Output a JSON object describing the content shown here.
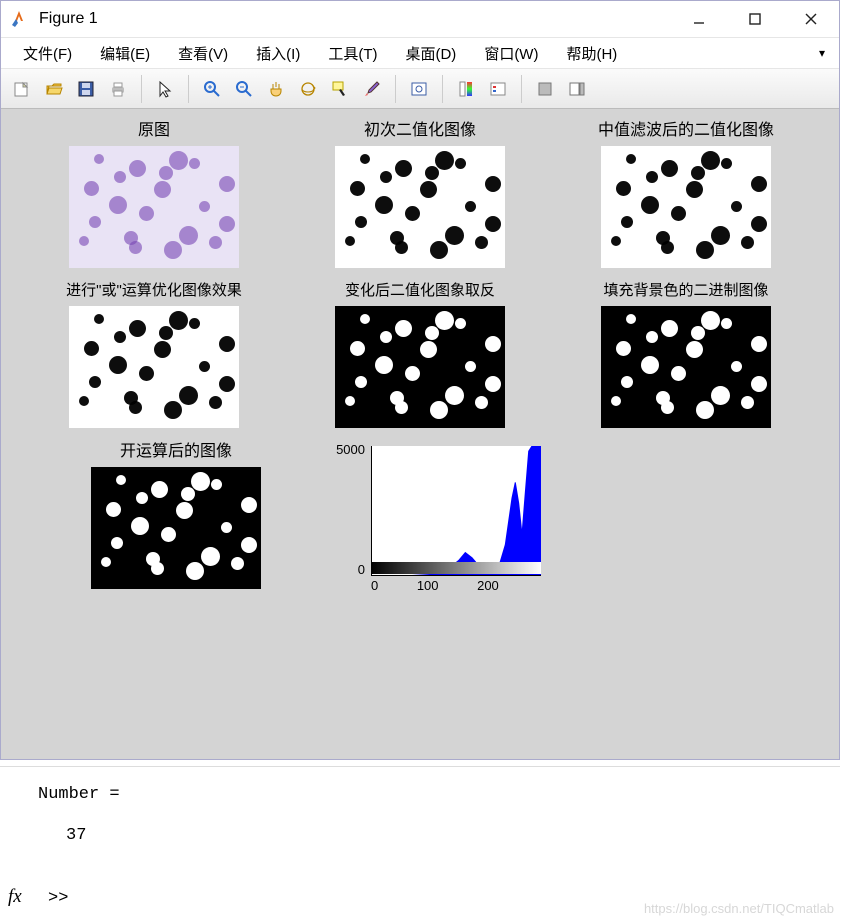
{
  "window": {
    "title": "Figure 1"
  },
  "menu": {
    "file": "文件(F)",
    "edit": "编辑(E)",
    "view": "查看(V)",
    "insert": "插入(I)",
    "tools": "工具(T)",
    "desktop": "桌面(D)",
    "window": "窗口(W)",
    "help": "帮助(H)"
  },
  "subplot_titles": {
    "r1c1": "原图",
    "r1c2": "初次二值化图像",
    "r1c3": "中值滤波后的二值化图像",
    "r2c1": "进行\"或\"运算优化图像效果",
    "r2c2": "变化后二值化图象取反",
    "r2c3": "填充背景色的二进制图像",
    "r3c1": "开运算后的图像"
  },
  "chart_data": {
    "type": "area",
    "title": "",
    "xlabel": "",
    "ylabel": "",
    "ylim": [
      0,
      5000
    ],
    "xlim": [
      0,
      255
    ],
    "xticks": [
      0,
      100,
      200
    ],
    "yticks": [
      0,
      5000
    ],
    "series": [
      {
        "name": "histogram",
        "x": [
          0,
          60,
          90,
          110,
          130,
          140,
          150,
          160,
          175,
          190,
          200,
          210,
          215,
          220,
          225,
          230,
          235,
          240,
          244,
          248,
          252,
          255
        ],
        "y": [
          0,
          20,
          60,
          180,
          600,
          900,
          700,
          400,
          250,
          350,
          1200,
          3000,
          3600,
          2800,
          1600,
          3200,
          4800,
          5000,
          5000,
          5000,
          5000,
          5000
        ]
      }
    ]
  },
  "console": {
    "var_line": "Number =",
    "value": "37",
    "prompt": ">>"
  },
  "watermark": "https://blog.csdn.net/TIQCmatlab"
}
